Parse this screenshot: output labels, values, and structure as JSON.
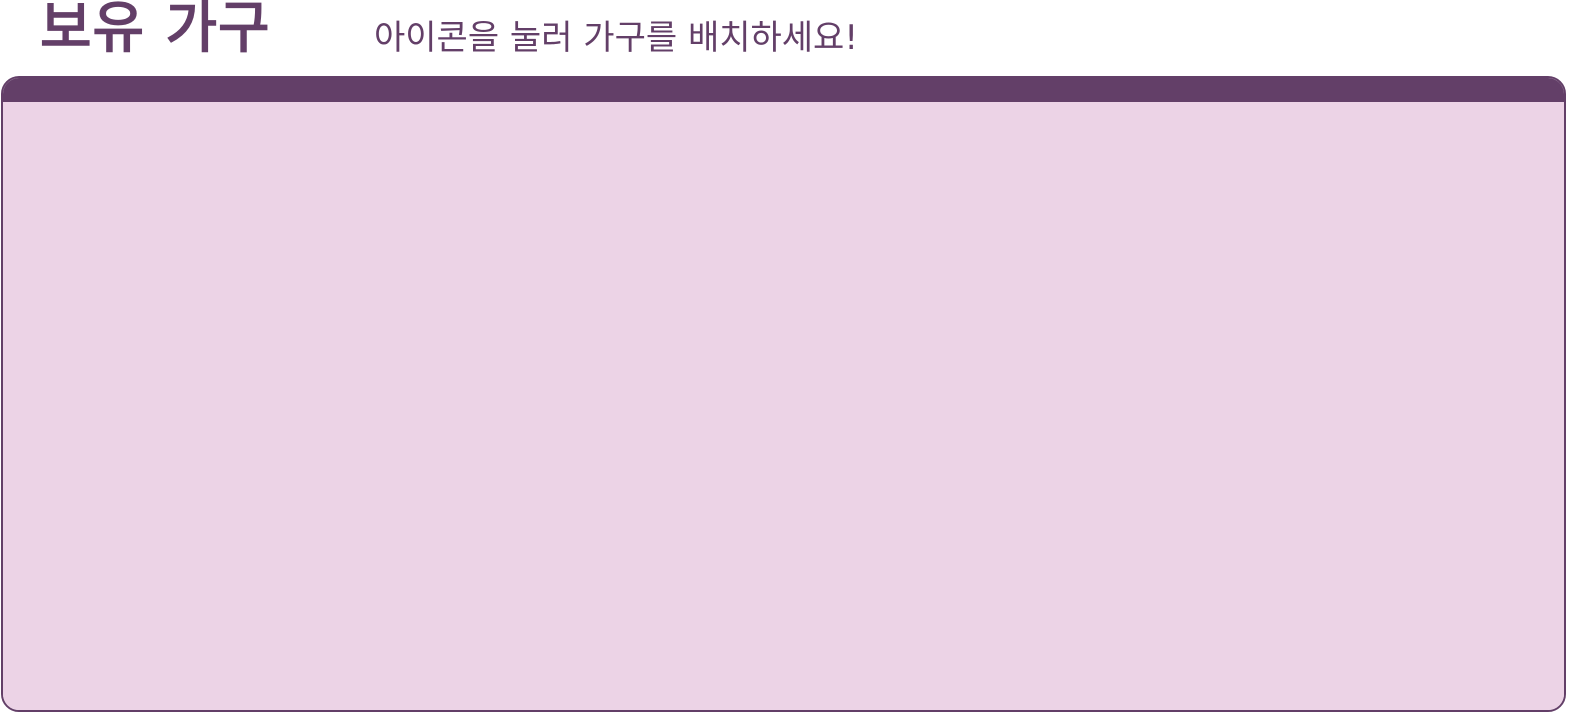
{
  "header": {
    "title": "보유 가구",
    "hint": "아이콘을 눌러 가구를 배치하세요!"
  },
  "furniture_panel": {
    "items": []
  },
  "colors": {
    "primary": "#633f68",
    "panel_body": "#ecd3e6",
    "background": "#ffffff"
  }
}
